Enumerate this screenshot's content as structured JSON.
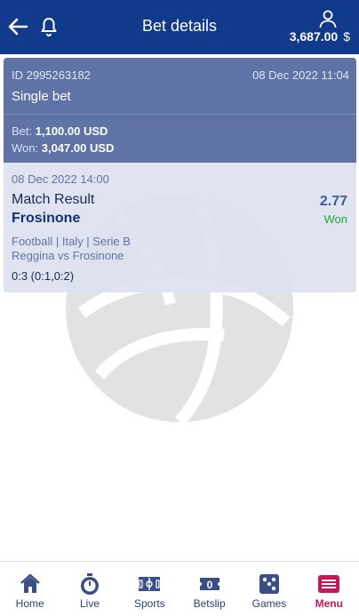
{
  "header": {
    "title": "Bet details",
    "balance_amount": "3,687.00",
    "balance_currency": "$"
  },
  "bet": {
    "id_text": "ID 2995263182",
    "placed_at": "08 Dec 2022 11:04",
    "type": "Single bet",
    "bet_label": "Bet:",
    "bet_amount": "1,100.00",
    "bet_currency": "USD",
    "won_label": "Won:",
    "won_amount": "3,047.00",
    "won_currency": "USD"
  },
  "event": {
    "date": "08 Dec 2022 14:00",
    "market": "Match Result",
    "odds": "2.77",
    "outcome": "Frosinone",
    "result": "Won",
    "league": "Football | Italy | Serie B",
    "match": "Reggina vs Frosinone",
    "score": "0:3 (0:1,0:2)"
  },
  "nav": {
    "items": [
      {
        "label": "Home",
        "icon": "home-icon"
      },
      {
        "label": "Live",
        "icon": "stopwatch-icon"
      },
      {
        "label": "Sports",
        "icon": "field-icon"
      },
      {
        "label": "Betslip",
        "icon": "ticket-icon"
      },
      {
        "label": "Games",
        "icon": "dice-icon"
      },
      {
        "label": "Menu",
        "icon": "menu-icon"
      }
    ],
    "betslip_count": "0",
    "active": "Menu"
  },
  "colors": {
    "header_bg": "#123a8a",
    "card_bg": "#5f73a6",
    "won_green": "#1ea83a",
    "menu_active": "#c2185b"
  }
}
